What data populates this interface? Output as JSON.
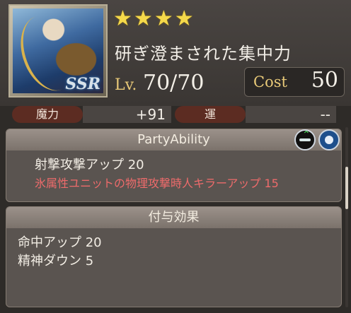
{
  "card": {
    "title": "研ぎ澄まされた集中力",
    "rarity": "SSR",
    "stars": 4,
    "level_label": "Lv.",
    "level": "70/70",
    "cost_label": "Cost",
    "cost": "50"
  },
  "stats": [
    {
      "label": "魔力",
      "value": "+91"
    },
    {
      "label": "運",
      "value": "--"
    }
  ],
  "party_ability": {
    "header": "PartyAbility",
    "lines": [
      {
        "text": "射撃攻撃アップ 20",
        "style": "normal"
      },
      {
        "text": "氷属性ユニットの物理攻撃時人キラーアップ 15",
        "style": "red"
      }
    ]
  },
  "grant_effect": {
    "header": "付与効果",
    "lines": [
      {
        "text": "命中アップ 20"
      },
      {
        "text": "精神ダウン 5"
      }
    ]
  },
  "colors": {
    "accent_gold": "#e8c978",
    "warning_red": "#ee6b6b",
    "star": "#f5d94a"
  },
  "icons": [
    "bow-attack-up-icon",
    "globe-emblem-icon"
  ]
}
